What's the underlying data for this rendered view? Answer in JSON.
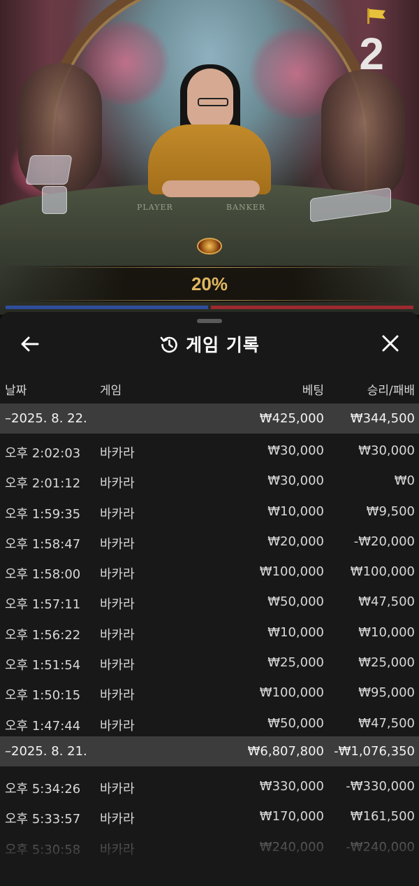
{
  "video": {
    "round_number": "2",
    "table_labels": {
      "player": "PLAYER",
      "banker": "BANKER"
    },
    "percentage": "20%",
    "colors": {
      "player": "#2f4d9c",
      "banker": "#9c2a2e",
      "accent": "#e0b860"
    }
  },
  "sheet": {
    "title": "게임 기록",
    "back_icon": "arrow-left-icon",
    "title_icon": "history-icon",
    "close_icon": "close-icon",
    "columns": {
      "date": "날짜",
      "game": "게임",
      "bet": "베팅",
      "result": "승리/패배"
    }
  },
  "groups": [
    {
      "date": "–2025. 8. 22.",
      "bet": "₩425,000",
      "result": "₩344,500",
      "rows": [
        {
          "time": "오후 2:02:03",
          "game": "바카라",
          "bet": "₩30,000",
          "result": "₩30,000"
        },
        {
          "time": "오후 2:01:12",
          "game": "바카라",
          "bet": "₩30,000",
          "result": "₩0"
        },
        {
          "time": "오후 1:59:35",
          "game": "바카라",
          "bet": "₩10,000",
          "result": "₩9,500"
        },
        {
          "time": "오후 1:58:47",
          "game": "바카라",
          "bet": "₩20,000",
          "result": "-₩20,000"
        },
        {
          "time": "오후 1:58:00",
          "game": "바카라",
          "bet": "₩100,000",
          "result": "₩100,000"
        },
        {
          "time": "오후 1:57:11",
          "game": "바카라",
          "bet": "₩50,000",
          "result": "₩47,500"
        },
        {
          "time": "오후 1:56:22",
          "game": "바카라",
          "bet": "₩10,000",
          "result": "₩10,000"
        },
        {
          "time": "오후 1:51:54",
          "game": "바카라",
          "bet": "₩25,000",
          "result": "₩25,000"
        },
        {
          "time": "오후 1:50:15",
          "game": "바카라",
          "bet": "₩100,000",
          "result": "₩95,000"
        },
        {
          "time": "오후 1:47:44",
          "game": "바카라",
          "bet": "₩50,000",
          "result": "₩47,500"
        }
      ]
    },
    {
      "date": "–2025. 8. 21.",
      "bet": "₩6,807,800",
      "result": "-₩1,076,350",
      "rows": [
        {
          "time": "오후 5:34:26",
          "game": "바카라",
          "bet": "₩330,000",
          "result": "-₩330,000"
        },
        {
          "time": "오후 5:33:57",
          "game": "바카라",
          "bet": "₩170,000",
          "result": "₩161,500"
        },
        {
          "time": "오후 5:30:58",
          "game": "바카라",
          "bet": "₩240,000",
          "result": "-₩240,000"
        }
      ]
    }
  ]
}
